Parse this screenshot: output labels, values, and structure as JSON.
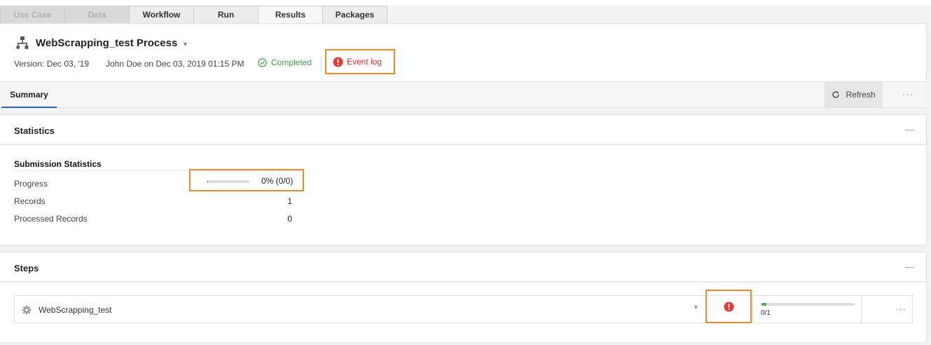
{
  "tabs": [
    {
      "label": "Use Case",
      "state": "disabled"
    },
    {
      "label": "Data",
      "state": "disabled"
    },
    {
      "label": "Workflow",
      "state": "normal"
    },
    {
      "label": "Run",
      "state": "normal"
    },
    {
      "label": "Results",
      "state": "active"
    },
    {
      "label": "Packages",
      "state": "normal"
    }
  ],
  "header": {
    "icon": "process-flow-icon",
    "title": "WebScrapping_test Process",
    "version": "Version: Dec 03, '19",
    "run_by": "John Doe on Dec 03, 2019 01:15 PM",
    "status": "Completed",
    "status_icon": "check-circle-icon",
    "event_log": "Event log",
    "event_log_icon": "error-circle-icon"
  },
  "subnav": {
    "tab": "Summary",
    "refresh": "Refresh",
    "more": "···"
  },
  "statistics": {
    "title": "Statistics",
    "collapse": "—",
    "heading": "Submission Statistics",
    "progress_label": "Progress",
    "progress_fraction": 0.02,
    "progress_text": "0% (0/0)",
    "records_label": "Records",
    "records_value": "1",
    "processed_label": "Processed Records",
    "processed_value": "0"
  },
  "steps": {
    "title": "Steps",
    "collapse": "—",
    "items": [
      {
        "name": "WebScrapping_test",
        "icon": "gear-icon",
        "status_icon": "error-circle-icon",
        "progress_fraction": 0.05,
        "progress_text": "0/1",
        "more": "···"
      }
    ]
  },
  "colors": {
    "accent": "#2d5fb3",
    "success": "#3fa33f",
    "error": "#d93131",
    "highlight": "#ef8a2a"
  }
}
